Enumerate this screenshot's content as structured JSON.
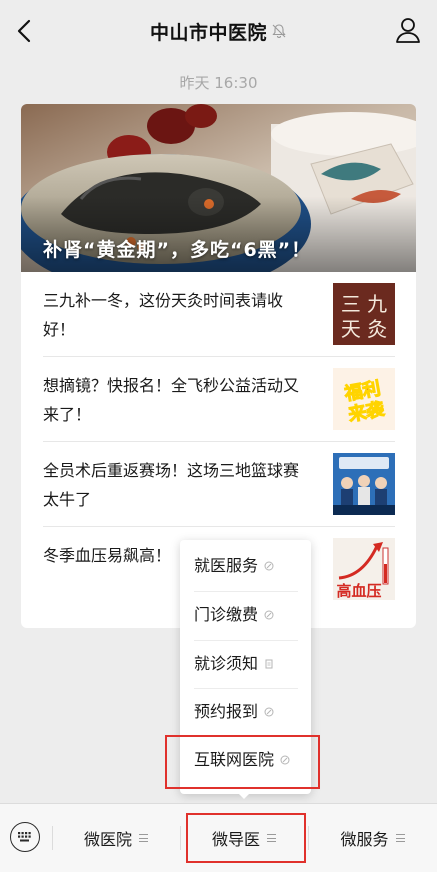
{
  "header": {
    "title": "中山市中医院",
    "back_icon": "back-chevron-icon",
    "mute_icon": "bell-mute-icon",
    "profile_icon": "user-icon"
  },
  "timestamp": "昨天 16:30",
  "article_card": {
    "hero": {
      "title": "补肾“黄金期”，多吃“6黑”！"
    },
    "items": [
      {
        "title": "三九补一冬，这份天灸时间表请收好！",
        "thumb_text": "三九天灸"
      },
      {
        "title": "想摘镜？快报名！全飞秒公益活动又来了！",
        "thumb_text": "福利来袭"
      },
      {
        "title": "全员术后重返赛场！这场三地篮球赛太牛了",
        "thumb_text": ""
      },
      {
        "title": "冬季血压易飙高！",
        "thumb_text": "高血压"
      }
    ]
  },
  "popup_menu": {
    "items": [
      {
        "label": "就医服务",
        "icon": "link-icon"
      },
      {
        "label": "门诊缴费",
        "icon": "link-icon"
      },
      {
        "label": "就诊须知",
        "icon": "document-icon"
      },
      {
        "label": "预约报到",
        "icon": "link-icon"
      },
      {
        "label": "互联网医院",
        "icon": "link-icon"
      }
    ]
  },
  "tabbar": {
    "keyboard_icon": "keyboard-icon",
    "tabs": [
      {
        "label": "微医院"
      },
      {
        "label": "微导医"
      },
      {
        "label": "微服务"
      }
    ]
  },
  "colors": {
    "highlight": "#e0312c",
    "background": "#ededed"
  }
}
